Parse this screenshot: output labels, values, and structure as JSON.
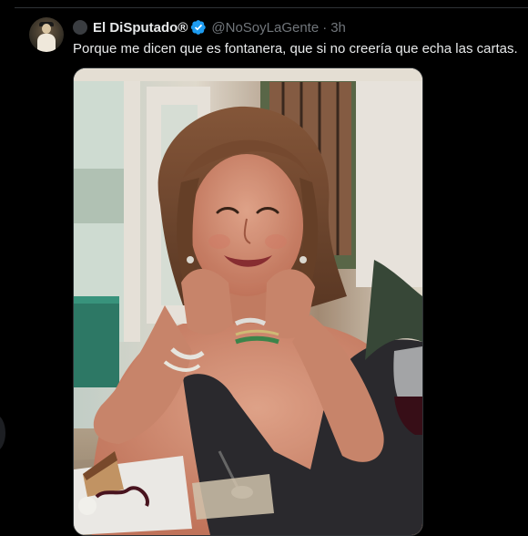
{
  "tweet": {
    "display_name": "El DiSputado®",
    "handle": "@NoSoyLaGente",
    "separator": "·",
    "time": "3h",
    "text": "Porque me dicen que es fontanera, que si no creería que echa las cartas.",
    "verified_icon": "verified-badge-icon",
    "media": {
      "kind": "photo"
    }
  },
  "colors": {
    "background": "#000000",
    "text_primary": "#e7e9ea",
    "text_secondary": "#71767b",
    "verified_blue": "#1d9bf0",
    "divider": "#2f3336"
  }
}
